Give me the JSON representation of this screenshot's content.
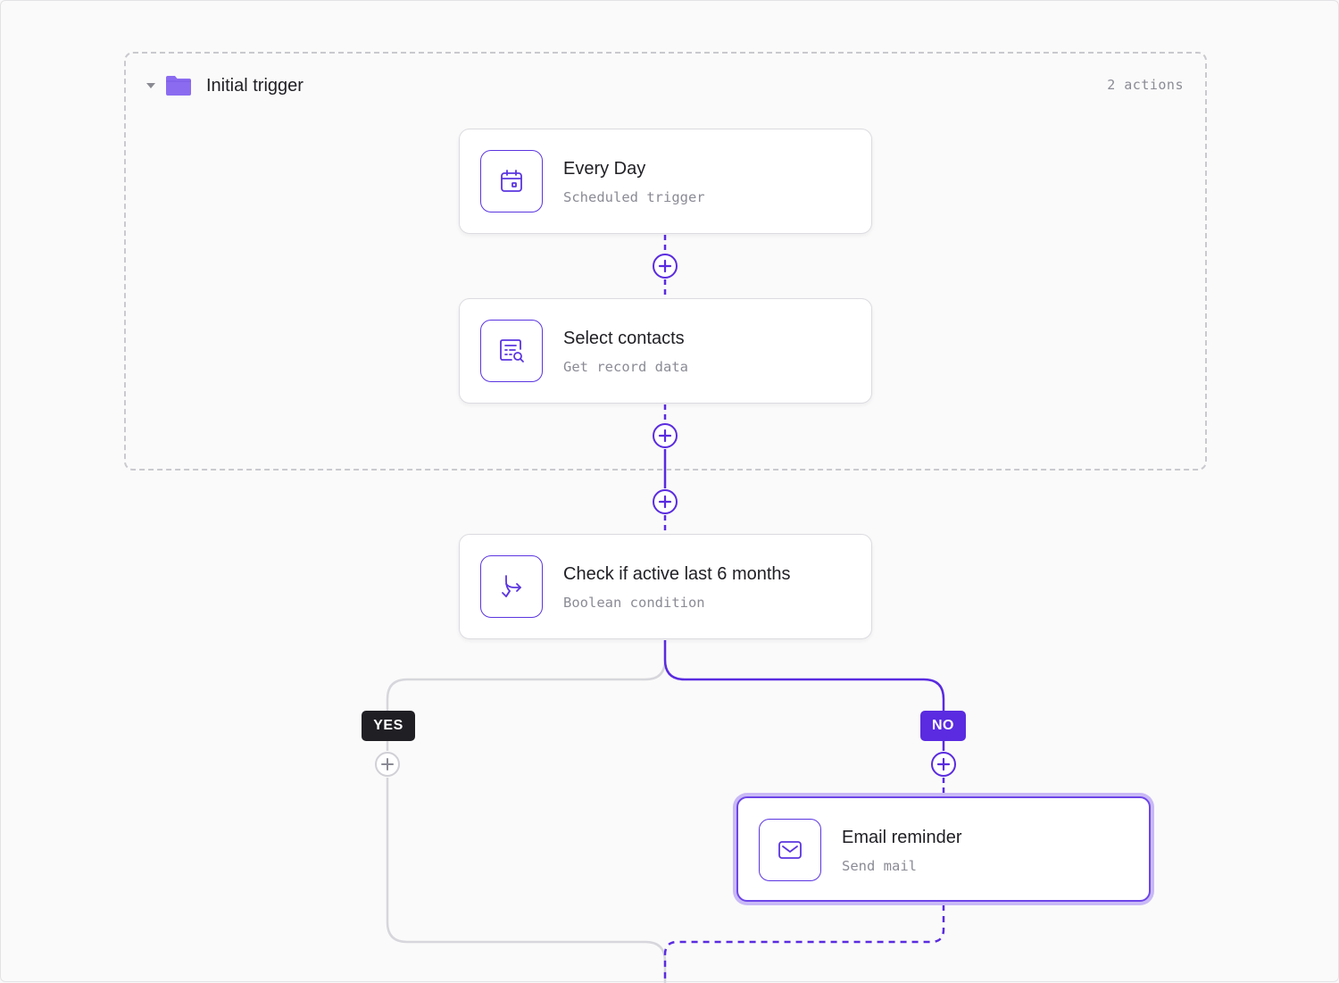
{
  "group": {
    "title": "Initial trigger",
    "count_label": "2 actions",
    "folder_color": "#8b6cf0"
  },
  "nodes": [
    {
      "id": "every-day",
      "title": "Every Day",
      "subtitle": "Scheduled trigger",
      "icon": "calendar-icon"
    },
    {
      "id": "select-contacts",
      "title": "Select contacts",
      "subtitle": "Get record data",
      "icon": "record-search-icon"
    },
    {
      "id": "check-active",
      "title": "Check if active last 6 months",
      "subtitle": "Boolean condition",
      "icon": "branch-icon"
    },
    {
      "id": "email-reminder",
      "title": "Email reminder",
      "subtitle": "Send mail",
      "icon": "mail-icon",
      "selected": true
    }
  ],
  "branches": {
    "yes_label": "YES",
    "no_label": "NO"
  },
  "colors": {
    "accent": "#5a2be0",
    "inactive_line": "#d6d6dc",
    "dark_badge": "#1f1f24",
    "selection_ring": "#c9b9f6"
  }
}
